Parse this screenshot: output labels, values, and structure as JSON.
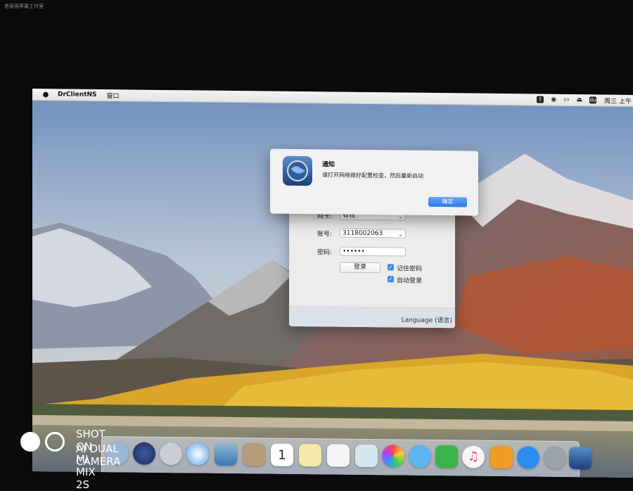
{
  "top_watermark": "老吴用苹果工作室",
  "menubar": {
    "app_name": "DrClientNS",
    "menus": [
      "窗口"
    ],
    "clock": "周三 上午"
  },
  "login": {
    "nic_label": "网卡:",
    "nic_value": "有线",
    "account_label": "账号:",
    "account_value": "3118002063",
    "password_label": "密码:",
    "password_value": "••••••",
    "login_button": "登录",
    "remember_password": "记住密码",
    "auto_login": "自动登录",
    "language": "Language (语言)"
  },
  "dialog": {
    "title": "通知",
    "message": "请打开网络做好配置检查，然后重新启动",
    "ok_button": "确定"
  },
  "calendar_day": "1",
  "camera_watermark": {
    "line1": "SHOT ON MI MIX 2S",
    "line2": "AI DUAL CAMERA"
  },
  "colors": {
    "accent_blue": "#2c7be5",
    "checkbox_blue": "#3d87e4"
  }
}
